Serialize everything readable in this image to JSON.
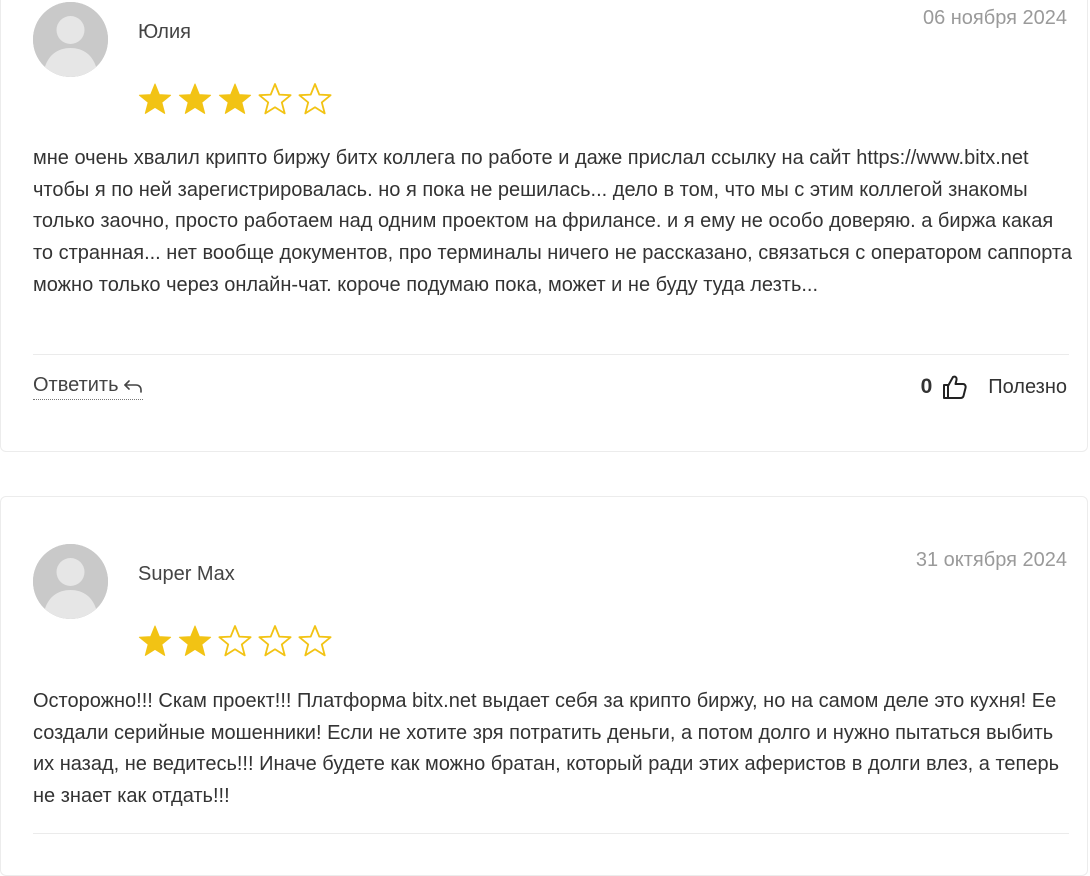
{
  "reviews": [
    {
      "author": "Юлия",
      "date": "06 ноября 2024",
      "rating": 3,
      "rating_max": 5,
      "text": "мне очень хвалил крипто биржу битх коллега по работе и даже прислал ссылку на сайт https://www.bitx.net чтобы я по ней зарегистрировалась. но я пока не решилась... дело в том, что мы с этим коллегой знакомы только заочно, просто работаем над одним проектом на фрилансе. и я ему не особо доверяю. а биржа какая то странная... нет вообще документов, про терминалы ничего не рассказано, связаться с оператором саппорта можно только через онлайн-чат. короче подумаю пока, может и не буду туда лезть...",
      "reply_label": "Ответить",
      "useful_count": "0",
      "useful_label": "Полезно"
    },
    {
      "author": "Super Max",
      "date": "31 октября 2024",
      "rating": 2,
      "rating_max": 5,
      "text": "Осторожно!!! Скам проект!!! Платформа bitx.net выдает себя за крипто биржу, но на самом деле это кухня! Ее создали серийные мошенники! Если не хотите зря потратить деньги, а потом долго и нужно пытаться выбить их назад, не ведитесь!!! Иначе будете как можно братан, который ради этих аферистов в долги влез, а теперь не знает как отдать!!!"
    }
  ],
  "colors": {
    "star_filled": "#f2c314",
    "star_outline": "#f2c314",
    "avatar_bg": "#c9c9c9",
    "avatar_fg": "#e6e6e6",
    "date": "#9a9a9a",
    "text": "#333333"
  },
  "icons": {
    "avatar": "default-user-avatar-icon",
    "star": "star-icon",
    "reply": "reply-arrow-icon",
    "like": "thumbs-up-icon"
  }
}
